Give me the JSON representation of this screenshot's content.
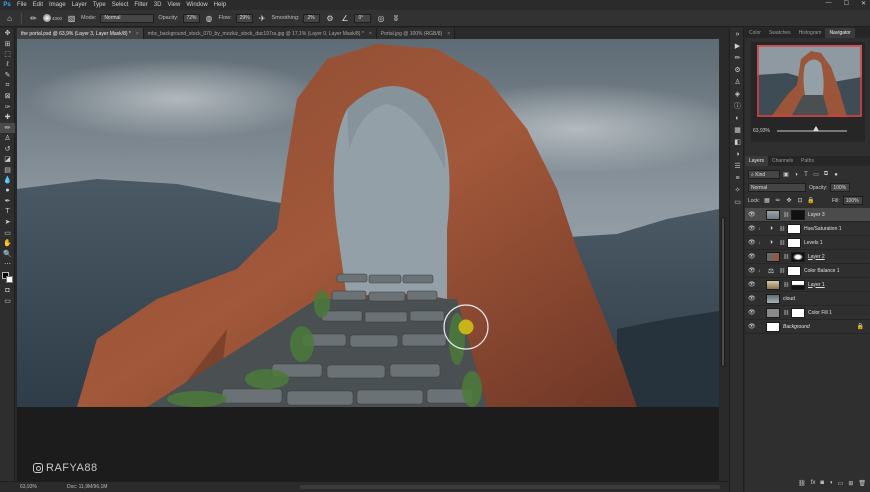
{
  "menubar": {
    "logo": "Ps",
    "items": [
      "File",
      "Edit",
      "Image",
      "Layer",
      "Type",
      "Select",
      "Filter",
      "3D",
      "View",
      "Window",
      "Help"
    ],
    "window_controls": [
      "—",
      "☐",
      "✕"
    ]
  },
  "options": {
    "brush_size": "4000",
    "mode_label": "Mode:",
    "mode_value": "Normal",
    "opacity_label": "Opacity:",
    "opacity_value": "72%",
    "flow_label": "Flow:",
    "flow_value": "29%",
    "smoothing_label": "Smoothing:",
    "smoothing_value": "2%",
    "angle_value": "0°"
  },
  "tabs": [
    {
      "title": "the portal.psd @ 63,9% (Layer 3, Layer Mask/8) *",
      "close": "×"
    },
    {
      "title": "mbc_background_stock_070_by_mozkiz_stock_dac197ra.jpg @ 17,1% (Layer 0, Layer Mask/8) *",
      "close": "×"
    },
    {
      "title": "Portal.jpg @ 100% (RGB/8)",
      "close": "×"
    }
  ],
  "tools": [
    {
      "icon": "move-icon",
      "glyph": "✥"
    },
    {
      "icon": "artboard-icon",
      "glyph": "⊞"
    },
    {
      "icon": "marquee-icon",
      "glyph": "⬚"
    },
    {
      "icon": "lasso-icon",
      "glyph": "ℓ"
    },
    {
      "icon": "quick-select-icon",
      "glyph": "✎"
    },
    {
      "icon": "crop-icon",
      "glyph": "⌗"
    },
    {
      "icon": "frame-icon",
      "glyph": "⊠"
    },
    {
      "icon": "eyedropper-icon",
      "glyph": "✑"
    },
    {
      "icon": "healing-brush-icon",
      "glyph": "✚"
    },
    {
      "icon": "brush-icon",
      "glyph": "✏"
    },
    {
      "icon": "clone-stamp-icon",
      "glyph": "♙"
    },
    {
      "icon": "history-brush-icon",
      "glyph": "↺"
    },
    {
      "icon": "eraser-icon",
      "glyph": "◪"
    },
    {
      "icon": "gradient-icon",
      "glyph": "▤"
    },
    {
      "icon": "blur-icon",
      "glyph": "💧"
    },
    {
      "icon": "dodge-icon",
      "glyph": "●"
    },
    {
      "icon": "pen-icon",
      "glyph": "✒"
    },
    {
      "icon": "type-icon",
      "glyph": "T"
    },
    {
      "icon": "path-select-icon",
      "glyph": "➤"
    },
    {
      "icon": "rectangle-tool-icon",
      "glyph": "▭"
    },
    {
      "icon": "hand-icon",
      "glyph": "✋"
    },
    {
      "icon": "zoom-icon",
      "glyph": "🔍"
    },
    {
      "icon": "more-tools-icon",
      "glyph": "⋯"
    }
  ],
  "active_tool_index": 9,
  "canvas": {
    "watermark": "RAFYA88"
  },
  "status": {
    "zoom": "63,93%",
    "doc": "Doc: 11,9M/96,1M"
  },
  "strip_icons": [
    {
      "icon": "collapse-icon",
      "glyph": "»"
    },
    {
      "icon": "play-icon",
      "glyph": "▶"
    },
    {
      "icon": "brush-settings-icon",
      "glyph": "✏"
    },
    {
      "icon": "tool-presets-icon",
      "glyph": "⚙"
    },
    {
      "icon": "clone-source-icon",
      "glyph": "♙"
    },
    {
      "icon": "3d-icon",
      "glyph": "◈"
    },
    {
      "icon": "info-icon",
      "glyph": "ⓘ"
    },
    {
      "icon": "color-icon",
      "glyph": "◐"
    },
    {
      "icon": "swatches-icon",
      "glyph": "▦"
    },
    {
      "icon": "layers-icon",
      "glyph": "◧"
    },
    {
      "icon": "adjustments-icon",
      "glyph": "◑"
    },
    {
      "icon": "properties-icon",
      "glyph": "☰"
    },
    {
      "icon": "channels-icon",
      "glyph": "≡"
    },
    {
      "icon": "paths-icon",
      "glyph": "✧"
    },
    {
      "icon": "comment-icon",
      "glyph": "▭"
    }
  ],
  "top_panel_tabs": [
    "Color",
    "Swatches",
    "Histogram",
    "Navigator"
  ],
  "navigator": {
    "zoom": "63,93%"
  },
  "layers_panel": {
    "tabs": [
      "Layers",
      "Channels",
      "Paths"
    ],
    "kind_value": "Kind",
    "blend_value": "Normal",
    "opacity_label": "Opacity:",
    "opacity_value": "100%",
    "lock_label": "Lock:",
    "fill_label": "Fill:",
    "fill_value": "100%",
    "layers": [
      {
        "name": "Layer 3",
        "kind": "pixel-mask",
        "selected": true
      },
      {
        "name": "Hue/Saturation 1",
        "kind": "adjustment"
      },
      {
        "name": "Levels 1",
        "kind": "adjustment"
      },
      {
        "name": "Layer 2",
        "kind": "pixel-mask"
      },
      {
        "name": "Color Balance 1",
        "kind": "adjustment"
      },
      {
        "name": "Layer 1",
        "kind": "pixel-mask"
      },
      {
        "name": "cloud",
        "kind": "pixel"
      },
      {
        "name": "Color Fill 1",
        "kind": "fill"
      },
      {
        "name": "Background",
        "kind": "background",
        "locked": true
      }
    ],
    "footer_icons": [
      "link-icon",
      "fx-icon",
      "add-mask-icon",
      "new-adjustment-icon",
      "new-group-icon",
      "new-layer-icon",
      "trash-icon"
    ]
  },
  "colors": {
    "accent": "#31a8ff",
    "navigator_frame": "#e03c3c",
    "cursor_dot": "#c8b418"
  }
}
